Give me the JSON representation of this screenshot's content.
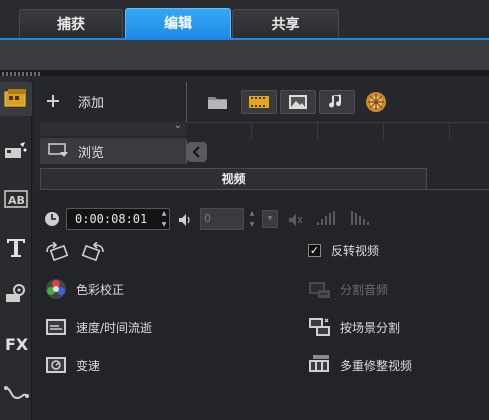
{
  "tabs": [
    {
      "label": "捕获",
      "active": false
    },
    {
      "label": "编辑",
      "active": true
    },
    {
      "label": "共享",
      "active": false
    }
  ],
  "library": {
    "categories": [
      {
        "label": "添加",
        "icon": "plus-icon"
      },
      {
        "label": "浏览",
        "icon": "browse-icon"
      }
    ],
    "media_filters": [
      "folder-icon",
      "video-filter-icon",
      "photo-filter-icon",
      "audio-filter-icon",
      "flash-filter-icon"
    ]
  },
  "options": {
    "title": "视频",
    "duration": "0:00:08:01",
    "volume_value": "0",
    "reverse_video_label": "反转视频",
    "reverse_video_checked": true,
    "color_correction_label": "色彩校正",
    "speed_timelapse_label": "速度/时间流逝",
    "variable_speed_label": "变速",
    "split_audio_label": "分割音频",
    "scene_split_label": "按场景分割",
    "multi_trim_label": "多重修整视频"
  },
  "colors": {
    "accent": "#1e88e5",
    "panel": "#232427"
  }
}
